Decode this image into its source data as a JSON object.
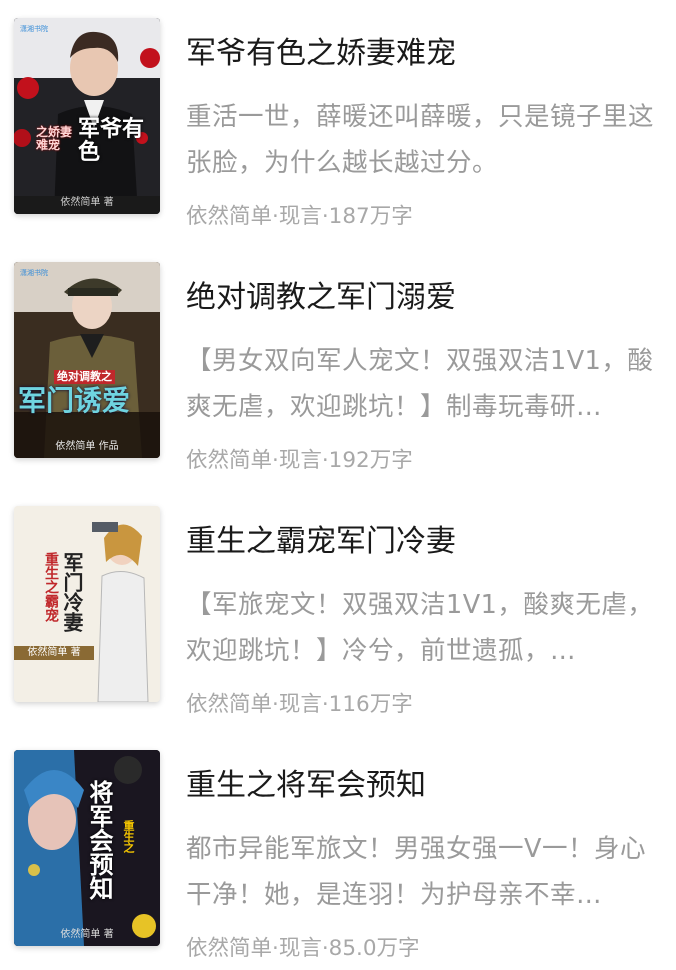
{
  "books": [
    {
      "title": "军爷有色之娇妻难宠",
      "description": "重活一世，薛暖还叫薛暖，只是镜子里这张脸，为什么越长越过分。",
      "meta": "依然简单·现言·187万字",
      "cover": {
        "tag": "潇湘书院",
        "title_text": "军爷有色",
        "subtitle_text": "之娇妻难宠",
        "author_text": "依然简单 著"
      }
    },
    {
      "title": "绝对调教之军门溺爱",
      "description": "【男女双向军人宠文！双强双洁1V1，酸爽无虐，欢迎跳坑！】制毒玩毒研…",
      "meta": "依然简单·现言·192万字",
      "cover": {
        "tag": "潇湘书院",
        "title_text": "军门诱爱",
        "subtitle_text": "绝对调教之",
        "author_text": "依然简单 作品"
      }
    },
    {
      "title": "重生之霸宠军门冷妻",
      "description": "【军旅宠文！双强双洁1V1，酸爽无虐，欢迎跳坑！】冷兮，前世遗孤，…",
      "meta": "依然简单·现言·116万字",
      "cover": {
        "tag": "",
        "title_text": "军门冷妻",
        "subtitle_text": "重生之霸宠",
        "author_text": "依然简单 著"
      }
    },
    {
      "title": "重生之将军会预知",
      "description": "都市异能军旅文！男强女强一V一！身心干净！她，是连羽！为护母亲不幸…",
      "meta": "依然简单·现言·85.0万字",
      "cover": {
        "tag": "",
        "title_text": "将军会预知",
        "subtitle_text": "重生之",
        "author_text": "依然简单 著"
      }
    }
  ]
}
